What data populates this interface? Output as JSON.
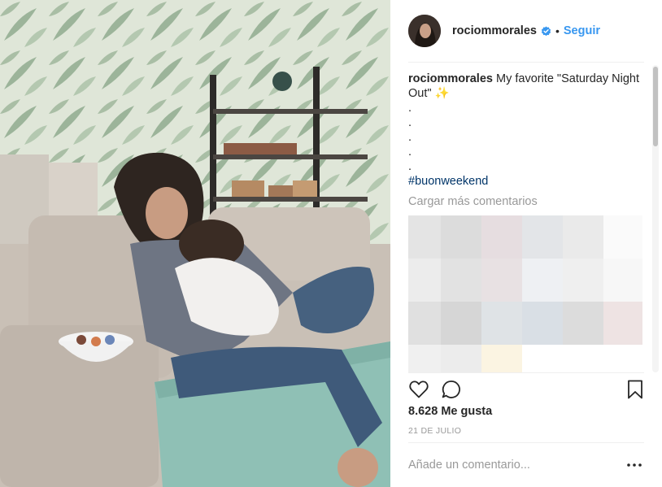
{
  "post": {
    "username": "rociommorales",
    "follow_label": "Seguir",
    "separator": "•",
    "caption_text": "My favorite \"Saturday Night Out\" ✨",
    "caption_dots": [
      ".",
      ".",
      ".",
      ".",
      "."
    ],
    "hashtag": "#buonweekend",
    "load_more_label": "Cargar más comentarios",
    "likes": "8.628 Me gusta",
    "date": "21 DE JULIO",
    "comment_placeholder": "Añade un comentario...",
    "more_label": "•••"
  },
  "icons": {
    "verified": "verified-badge-icon",
    "like": "heart-icon",
    "comment": "comment-bubble-icon",
    "save": "bookmark-icon",
    "more": "more-options-icon"
  },
  "colors": {
    "link_blue": "#3897f0",
    "hashtag_blue": "#003569",
    "muted_gray": "#999999",
    "text": "#262626",
    "divider": "#efefef"
  },
  "blur_cells": [
    "#e4e4e4",
    "#dcdcdc",
    "#e6dde0",
    "#e3e5e8",
    "#eaeaea",
    "#fafafa",
    "#ececec",
    "#e2e2e2",
    "#e8e1e3",
    "#eef0f3",
    "#efefef",
    "#f7f7f7",
    "#e0e0e0",
    "#d6d6d6",
    "#dfe3e6",
    "#d9dfe5",
    "#dcdcdc",
    "#eee3e3",
    "#f0f0f0",
    "#ececec",
    "#fbf4e2",
    "#ffffff",
    "#ffffff",
    "#ffffff"
  ]
}
